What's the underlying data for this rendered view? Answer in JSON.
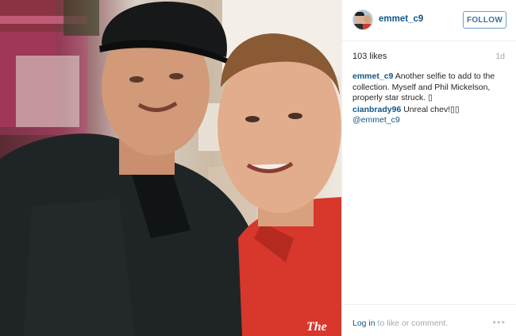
{
  "post": {
    "image_alt": "Selfie of two men, one in a black cap and dark jacket, one in a red polo shirt",
    "shirt_logo_text": "The"
  },
  "header": {
    "username": "emmet_c9",
    "follow_label": "FOLLOW"
  },
  "stats": {
    "likes": "103 likes",
    "age": "1d"
  },
  "comments": [
    {
      "author": "emmet_c9",
      "text": " Another selfie to add to the collection. Myself and Phil Mickelson, properly star struck. ▯"
    },
    {
      "author": "cianbrady96",
      "text": " Unreal chev!▯▯ ",
      "mention": "@emmet_c9"
    }
  ],
  "footer": {
    "login_label": "Log in",
    "login_suffix": " to like or comment.",
    "more_label": "•••"
  },
  "colors": {
    "link": "#125688",
    "follow_border": "#6d9ed1",
    "muted": "#a5a7aa"
  }
}
